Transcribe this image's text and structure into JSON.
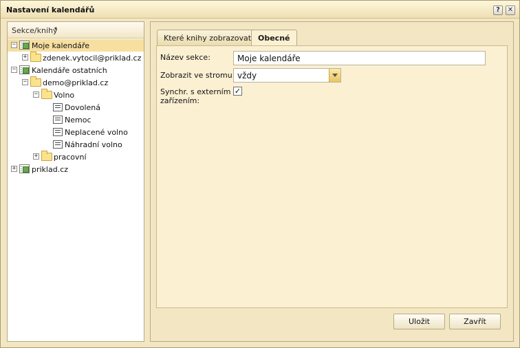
{
  "window": {
    "title": "Nastavení kalendářů",
    "help_label": "?",
    "close_label": "✕"
  },
  "sidebar": {
    "header_label": "Sekce/knihy",
    "header_caret": "▾",
    "tree": [
      {
        "label": "Moje kalendáře",
        "icon": "book-icon",
        "toggle": "−",
        "selected": true
      },
      {
        "label": "zdenek.vytocil@priklad.cz",
        "icon": "folder-icon",
        "toggle": "+"
      },
      {
        "label": "Kalendáře ostatních",
        "icon": "book-icon",
        "toggle": "−"
      },
      {
        "label": "demo@priklad.cz",
        "icon": "folder-icon",
        "toggle": "−"
      },
      {
        "label": "Volno",
        "icon": "folder-icon",
        "toggle": "−"
      },
      {
        "label": "Dovolená",
        "icon": "calendar-icon"
      },
      {
        "label": "Nemoc",
        "icon": "calendar-icon"
      },
      {
        "label": "Neplacené volno",
        "icon": "calendar-icon"
      },
      {
        "label": "Náhradní volno",
        "icon": "calendar-icon"
      },
      {
        "label": "pracovní",
        "icon": "folder-icon",
        "toggle": "+"
      },
      {
        "label": "priklad.cz",
        "icon": "book-icon",
        "toggle": "+"
      }
    ]
  },
  "tabs": [
    {
      "label": "Které knihy zobrazovat",
      "active": false
    },
    {
      "label": "Obecné",
      "active": true
    }
  ],
  "form": {
    "section_name_label": "Název sekce:",
    "section_name_value": "Moje kalendáře",
    "show_in_tree_label": "Zobrazit ve stromu:",
    "show_in_tree_value": "vždy",
    "sync_label_line1": "Synchr. s externím",
    "sync_label_line2": "zařízením:",
    "sync_checked": true,
    "sync_check_glyph": "✓"
  },
  "buttons": {
    "save_label": "Uložit",
    "close_label": "Zavřít"
  }
}
